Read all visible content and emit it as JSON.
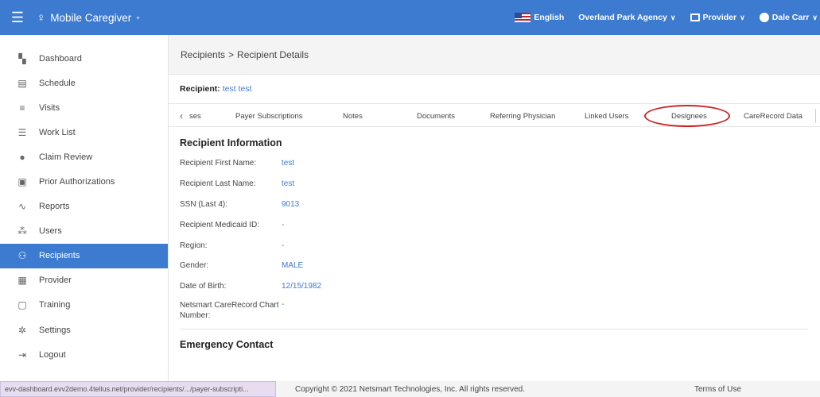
{
  "app": {
    "title": "Mobile Caregiver",
    "trademark": "+",
    "language": "English",
    "agency": "Overland Park Agency",
    "role": "Provider",
    "user": "Dale Carr"
  },
  "sidebar": {
    "items": [
      {
        "label": "Dashboard",
        "icon": "dashboard-icon",
        "glyph": "▚"
      },
      {
        "label": "Schedule",
        "icon": "schedule-icon",
        "glyph": "▤"
      },
      {
        "label": "Visits",
        "icon": "visits-icon",
        "glyph": "≡"
      },
      {
        "label": "Work List",
        "icon": "worklist-icon",
        "glyph": "☰"
      },
      {
        "label": "Claim Review",
        "icon": "claim-review-icon",
        "glyph": "●"
      },
      {
        "label": "Prior Authorizations",
        "icon": "prior-auth-icon",
        "glyph": "▣"
      },
      {
        "label": "Reports",
        "icon": "reports-icon",
        "glyph": "∿"
      },
      {
        "label": "Users",
        "icon": "users-icon",
        "glyph": "⁂"
      },
      {
        "label": "Recipients",
        "icon": "recipients-icon",
        "glyph": "⚇"
      },
      {
        "label": "Provider",
        "icon": "provider-icon",
        "glyph": "▦"
      },
      {
        "label": "Training",
        "icon": "training-icon",
        "glyph": "▢"
      },
      {
        "label": "Settings",
        "icon": "settings-icon",
        "glyph": "✲"
      },
      {
        "label": "Logout",
        "icon": "logout-icon",
        "glyph": "⇥"
      }
    ],
    "active_index": 8
  },
  "breadcrumb": {
    "parent": "Recipients",
    "separator": ">",
    "current": "Recipient Details"
  },
  "recipient": {
    "label": "Recipient:",
    "name": "test test"
  },
  "tabs": [
    {
      "label": "ses"
    },
    {
      "label": "Payer Subscriptions"
    },
    {
      "label": "Notes"
    },
    {
      "label": "Documents"
    },
    {
      "label": "Referring Physician"
    },
    {
      "label": "Linked Users"
    },
    {
      "label": "Designees"
    },
    {
      "label": "CareRecord Data"
    }
  ],
  "recipient_info": {
    "title": "Recipient Information",
    "rows": [
      {
        "label": "Recipient First Name:",
        "value": "test"
      },
      {
        "label": "Recipient Last Name:",
        "value": "test"
      },
      {
        "label": "SSN (Last 4):",
        "value": "9013"
      },
      {
        "label": "Recipient Medicaid ID:",
        "value": "-"
      },
      {
        "label": "Region:",
        "value": "-"
      },
      {
        "label": "Gender:",
        "value": "MALE"
      },
      {
        "label": "Date of Birth:",
        "value": "12/15/1982"
      },
      {
        "label": "Netsmart CareRecord Chart Number:",
        "value": "-"
      }
    ]
  },
  "emergency_contact": {
    "title": "Emergency Contact"
  },
  "footer": {
    "status_url": "evv-dashboard.evv2demo.4tellus.net/provider/recipients/.../payer-subscripti...",
    "copyright": "Copyright © 2021 Netsmart Technologies, Inc. All rights reserved.",
    "terms": "Terms of Use"
  },
  "colors": {
    "primary": "#3d7bd0",
    "highlight_oval": "#cc2222"
  }
}
